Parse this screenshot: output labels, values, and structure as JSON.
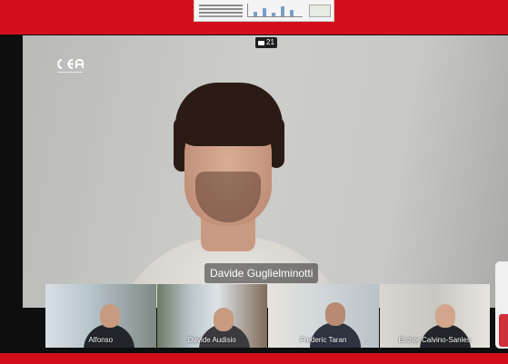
{
  "speaker": {
    "name": "Davide Guglielminotti"
  },
  "meeting": {
    "participant_count": "21"
  },
  "thumbnails": [
    {
      "name": "Alfonso"
    },
    {
      "name": "Davide Audisio"
    },
    {
      "name": "Frederic Taran"
    },
    {
      "name": "Esther Calvino-Sanles"
    }
  ],
  "icons": {
    "logo": "organization-logo",
    "camera": "camera-icon"
  },
  "colors": {
    "accent_bar": "#d40f1b",
    "label_background": "#282828"
  }
}
